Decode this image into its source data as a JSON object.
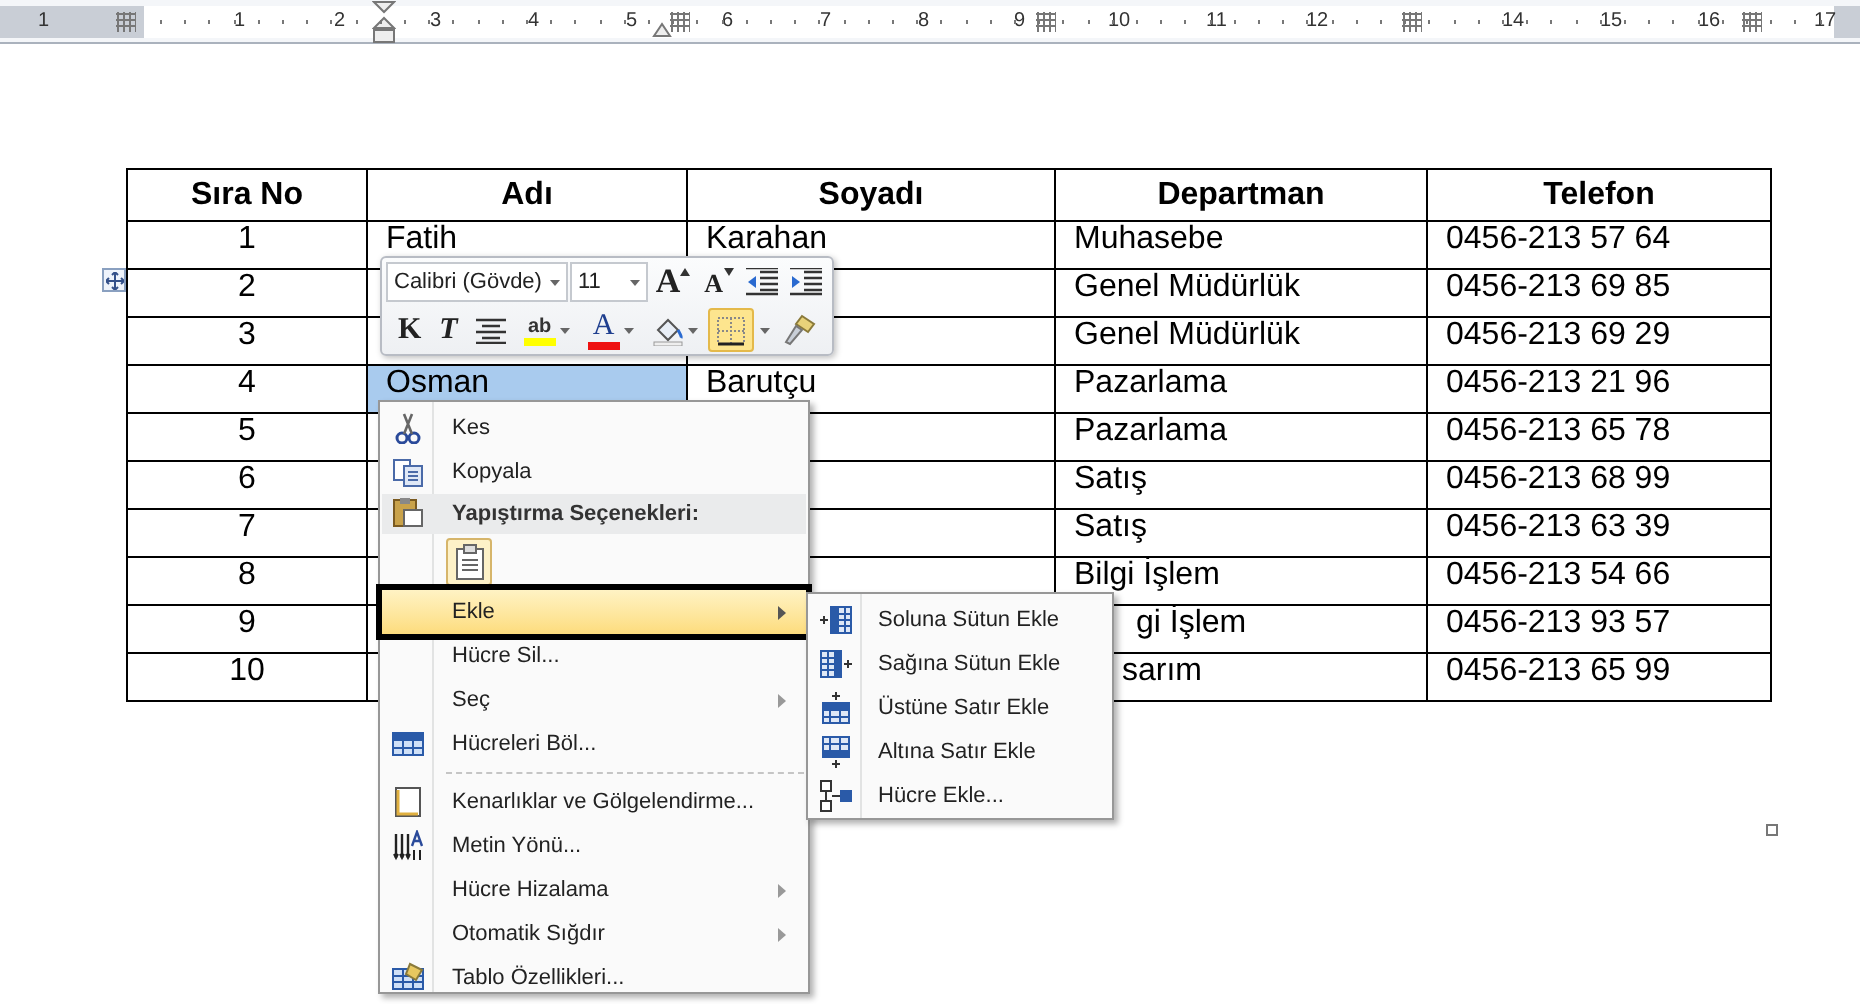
{
  "ruler": {
    "labels": [
      "1",
      "1",
      "2",
      "3",
      "4",
      "5",
      "6",
      "7",
      "8",
      "9",
      "10",
      "11",
      "12",
      "14",
      "15",
      "16",
      "17"
    ]
  },
  "table": {
    "columns": [
      "Sıra No",
      "Adı",
      "Soyadı",
      "Departman",
      "Telefon"
    ],
    "rows": [
      {
        "cells": [
          "1",
          "Fatih",
          "Karahan",
          "Muhasebe",
          "0456-213 57 64"
        ],
        "selected": false
      },
      {
        "cells": [
          "2",
          null,
          null,
          "Genel Müdürlük",
          "0456-213 69 85"
        ],
        "selected": false
      },
      {
        "cells": [
          "3",
          null,
          null,
          "Genel Müdürlük",
          "0456-213 69 29"
        ],
        "selected": false
      },
      {
        "cells": [
          "4",
          "Osman",
          "Barutçu",
          "Pazarlama",
          "0456-213 21 96"
        ],
        "selected": true
      },
      {
        "cells": [
          "5",
          null,
          null,
          "Pazarlama",
          "0456-213 65 78"
        ],
        "selected": false
      },
      {
        "cells": [
          "6",
          null,
          null,
          "Satış",
          "0456-213 68 99"
        ],
        "selected": false
      },
      {
        "cells": [
          "7",
          null,
          null,
          "Satış",
          "0456-213 63 39"
        ],
        "selected": false
      },
      {
        "cells": [
          "8",
          null,
          null,
          "Bilgi İşlem",
          "0456-213 54 66"
        ],
        "selected": false
      },
      {
        "cells": [
          "9",
          null,
          null,
          "gi İşlem",
          "0456-213 93 57"
        ],
        "selected": false
      },
      {
        "cells": [
          "10",
          null,
          null,
          "sarım",
          "0456-213 65 99"
        ],
        "selected": false
      }
    ]
  },
  "mini_toolbar": {
    "row_1": [
      {
        "kind": "font",
        "value": "Calibri (Gövde)"
      },
      {
        "kind": "size",
        "value": "11"
      },
      {
        "kind": "grow",
        "label": "A"
      },
      {
        "kind": "shrink",
        "label": "A"
      },
      {
        "kind": "outdent"
      },
      {
        "kind": "indent"
      }
    ],
    "row_2": [
      {
        "kind": "bold",
        "label": "K",
        "active": false
      },
      {
        "kind": "italic",
        "label": "T",
        "active": false
      },
      {
        "kind": "center",
        "active": false
      },
      {
        "kind": "highlight",
        "label": "ab",
        "active": false
      },
      {
        "kind": "font_color",
        "label": "A",
        "active": false
      },
      {
        "kind": "shading",
        "active": false
      },
      {
        "kind": "borders",
        "active": true
      },
      {
        "kind": "painter",
        "active": false
      }
    ]
  },
  "context_menu": [
    {
      "kind": "item",
      "label": "Kes",
      "submenu": false,
      "selected": false
    },
    {
      "kind": "item",
      "label": "Kopyala",
      "submenu": false,
      "selected": false
    },
    {
      "kind": "header",
      "label": "Yapıştırma Seçenekleri:"
    },
    {
      "kind": "paste_options"
    },
    {
      "kind": "item",
      "label": "Ekle",
      "submenu": true,
      "selected": true
    },
    {
      "kind": "item",
      "label": "Hücre Sil...",
      "submenu": false,
      "selected": false
    },
    {
      "kind": "item",
      "label": "Seç",
      "submenu": true,
      "selected": false
    },
    {
      "kind": "item",
      "label": "Hücreleri Böl...",
      "submenu": false,
      "selected": false
    },
    {
      "kind": "separator"
    },
    {
      "kind": "item",
      "label": "Kenarlıklar ve Gölgelendirme...",
      "submenu": false,
      "selected": false
    },
    {
      "kind": "item",
      "label": "Metin Yönü...",
      "submenu": false,
      "selected": false
    },
    {
      "kind": "item",
      "label": "Hücre Hizalama",
      "submenu": true,
      "selected": false
    },
    {
      "kind": "item",
      "label": "Otomatik Sığdır",
      "submenu": true,
      "selected": false
    },
    {
      "kind": "item",
      "label": "Tablo Özellikleri...",
      "submenu": false,
      "selected": false
    }
  ],
  "submenu": [
    {
      "label": "Soluna Sütun Ekle"
    },
    {
      "label": "Sağına Sütun Ekle"
    },
    {
      "label": "Üstüne Satır Ekle"
    },
    {
      "label": "Altına Satır Ekle"
    },
    {
      "label": "Hücre Ekle..."
    }
  ]
}
